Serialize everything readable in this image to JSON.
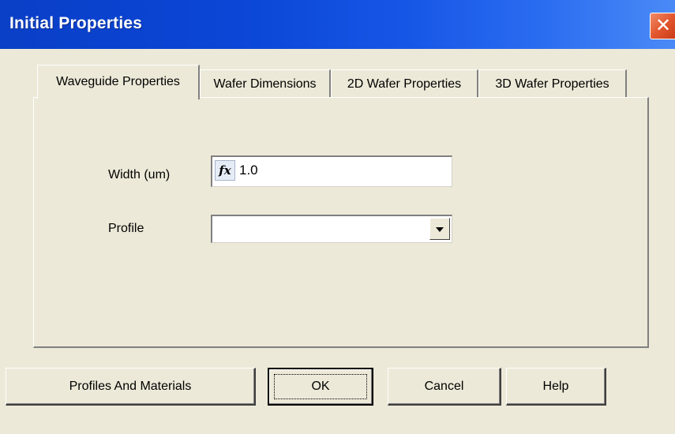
{
  "window": {
    "title": "Initial Properties",
    "close_glyph": "✕",
    "accent_color": "#0a3fc7",
    "close_color": "#e2572f"
  },
  "tabs": [
    {
      "label": "Waveguide Properties",
      "active": true
    },
    {
      "label": "Wafer Dimensions",
      "active": false
    },
    {
      "label": "2D Wafer Properties",
      "active": false
    },
    {
      "label": "3D Wafer Properties",
      "active": false
    }
  ],
  "form": {
    "width_label": "Width (um)",
    "width_icon": "fx-icon",
    "width_icon_text": "fx",
    "width_value": "1.0",
    "profile_label": "Profile",
    "profile_value": ""
  },
  "buttons": {
    "profiles_materials": "Profiles And Materials",
    "ok": "OK",
    "cancel": "Cancel",
    "help": "Help"
  }
}
